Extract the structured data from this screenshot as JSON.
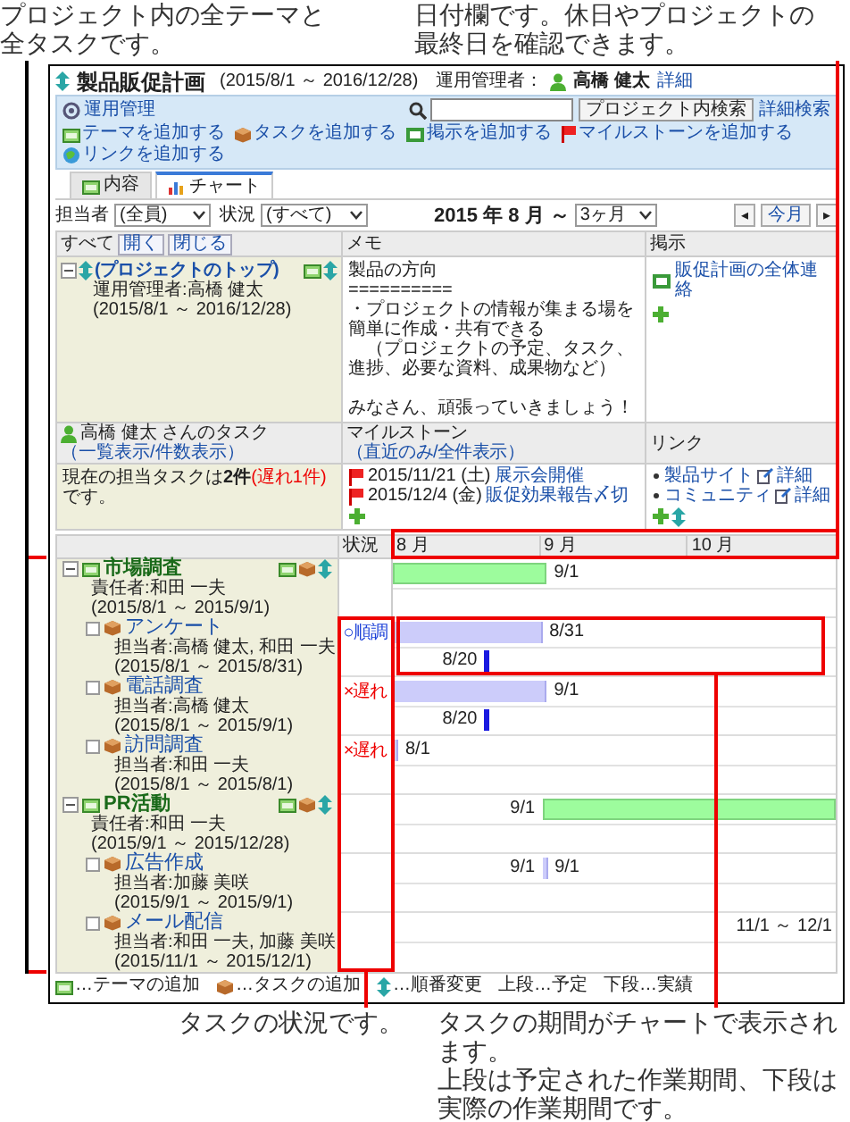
{
  "callouts": [
    {
      "lines": [
        "プロジェクト内の全テーマと全タスクです。"
      ]
    },
    {
      "lines": [
        "日付欄です。休日やプロジェクトの最終日を確認できます。"
      ]
    },
    {
      "lines": [
        "タスクの状況です。"
      ]
    },
    {
      "lines": [
        "タスクの期間がチャートで表示されます。",
        "上段は予定された作業期間、下段は実際の作業期間です。"
      ]
    }
  ],
  "project": {
    "title": "製品販促計画",
    "period": "(2015/8/1 ～ 2016/12/28)",
    "manager_label": "運用管理者：",
    "manager": "高橋 健太",
    "detail_link": "詳細"
  },
  "toolbar": {
    "admin_link": "運用管理",
    "search_button": "プロジェクト内検索",
    "advanced_search_link": "詳細検索",
    "actions": [
      {
        "kind": "theme",
        "label": "テーマを追加する"
      },
      {
        "kind": "task",
        "label": "タスクを追加する"
      },
      {
        "kind": "post",
        "label": "掲示を追加する"
      },
      {
        "kind": "milestone",
        "label": "マイルストーンを追加する"
      },
      {
        "kind": "link",
        "label": "リンクを追加する"
      }
    ]
  },
  "tabs": [
    {
      "kind": "content",
      "label": "内容",
      "selected": false
    },
    {
      "kind": "chart",
      "label": "チャート",
      "selected": true
    }
  ],
  "filters": {
    "assignee_label": "担当者",
    "assignee": "(全員)",
    "status_label": "状況",
    "status": "(すべて)",
    "period_heading": "2015 年 8 月 ～",
    "range": "3ヶ月",
    "prev_button": "◂",
    "today_button": "今月",
    "next_button": "▸"
  },
  "overview": {
    "all_label": "すべて",
    "expand_button": "開く",
    "collapse_button": "閉じる",
    "memo_heading": "メモ",
    "board_heading": "掲示",
    "top": {
      "title": "(プロジェクトのトップ)",
      "expanded": true,
      "manager": "運用管理者:高橋 健太",
      "dates": "(2015/8/1 ～ 2016/12/28)",
      "tools": [
        {
          "kind": "theme"
        },
        {
          "kind": "reorder"
        }
      ]
    },
    "memo_paragraphs": [
      [
        "製品の方向",
        "==========",
        "・プロジェクトの情報が集まる場を簡単に作成・共有できる",
        "　（プロジェクトの予定、タスク、進捗、必要な資料、成果物など）"
      ],
      [
        "みなさん、頑張っていきましょう！"
      ]
    ],
    "board_items": [
      "販促計画の全体連絡"
    ],
    "tasks_heading": "高橋 健太 さんのタスク",
    "tasks_views": "（一覧表示/件数表示）",
    "milestones_heading": "マイルストーン",
    "milestones_views": "（直近のみ/全件表示）",
    "links_heading": "リンク",
    "task_summary": [
      {
        "text": "現在の担当タスクは"
      },
      {
        "text": "2件",
        "kind": "bold"
      },
      {
        "text": "(遅れ1件)",
        "kind": "alert"
      },
      {
        "text": "です。"
      }
    ],
    "milestones": [
      {
        "date": "2015/11/21 (土)",
        "title": "展示会開催"
      },
      {
        "date": "2015/12/4 (金)",
        "title": "販促効果報告〆切"
      }
    ],
    "links": [
      {
        "title": "製品サイト",
        "detail": "詳細"
      },
      {
        "title": "コミュニティ",
        "detail": "詳細"
      }
    ]
  },
  "gantt": {
    "status_heading": "状況",
    "months": [
      "8 月",
      "9 月",
      "10 月"
    ],
    "themes": [
      {
        "kind": "theme",
        "title": "市場調査",
        "expanded": true,
        "owner": "責任者:和田 一夫",
        "dates": "(2015/8/1 ～ 2015/9/1)",
        "tools": [
          {
            "kind": "theme"
          },
          {
            "kind": "task"
          },
          {
            "kind": "reorder"
          }
        ],
        "plan_labels": [
          {
            "text": "9/1",
            "kind": "after"
          }
        ],
        "children": [
          {
            "kind": "task",
            "title": "アンケート",
            "owner": "担当者:高橋 健太, 和田 一夫",
            "dates": "(2015/8/1 ～ 2015/8/31)",
            "status": {
              "text": "○順調",
              "kind": "ok"
            },
            "plan_labels": [
              {
                "text": "8/31",
                "kind": "after"
              }
            ],
            "actual": {
              "label": "8/20"
            }
          },
          {
            "kind": "task",
            "title": "電話調査",
            "owner": "担当者:高橋 健太",
            "dates": "(2015/8/1 ～ 2015/9/1)",
            "status": {
              "text": "×遅れ",
              "kind": "late"
            },
            "plan_labels": [
              {
                "text": "9/1",
                "kind": "after"
              }
            ],
            "actual": {
              "label": "8/20"
            }
          },
          {
            "kind": "task",
            "title": "訪問調査",
            "owner": "担当者:和田 一夫",
            "dates": "(2015/8/1 ～ 2015/8/1)",
            "status": {
              "text": "×遅れ",
              "kind": "late"
            },
            "plan_labels": [
              {
                "text": "8/1",
                "kind": "after"
              }
            ]
          }
        ]
      },
      {
        "kind": "theme",
        "title": "PR活動",
        "expanded": true,
        "owner": "責任者:和田 一夫",
        "dates": "(2015/9/1 ～ 2015/12/28)",
        "tools": [
          {
            "kind": "theme"
          },
          {
            "kind": "task"
          },
          {
            "kind": "reorder"
          }
        ],
        "plan_labels": [
          {
            "text": "9/1",
            "kind": "before"
          }
        ],
        "children": [
          {
            "kind": "task",
            "title": "広告作成",
            "owner": "担当者:加藤 美咲",
            "dates": "(2015/9/1 ～ 2015/9/1)",
            "plan_labels": [
              {
                "text": "9/1",
                "kind": "before"
              },
              {
                "text": "9/1",
                "kind": "after"
              }
            ]
          },
          {
            "kind": "task",
            "title": "メール配信",
            "owner": "担当者:和田 一夫, 加藤 美咲",
            "dates": "(2015/11/1 ～ 2015/12/1)",
            "plan_labels": [
              {
                "text": "11/1 ～ 12/1",
                "kind": "edge"
              }
            ]
          }
        ]
      }
    ]
  },
  "legend": [
    {
      "kind": "theme",
      "text": "…テーマの追加"
    },
    {
      "kind": "task",
      "text": "…タスクの追加"
    },
    {
      "kind": "reorder",
      "text": "…順番変更"
    },
    {
      "text": "上段…予定"
    },
    {
      "text": "下段…実績"
    }
  ]
}
